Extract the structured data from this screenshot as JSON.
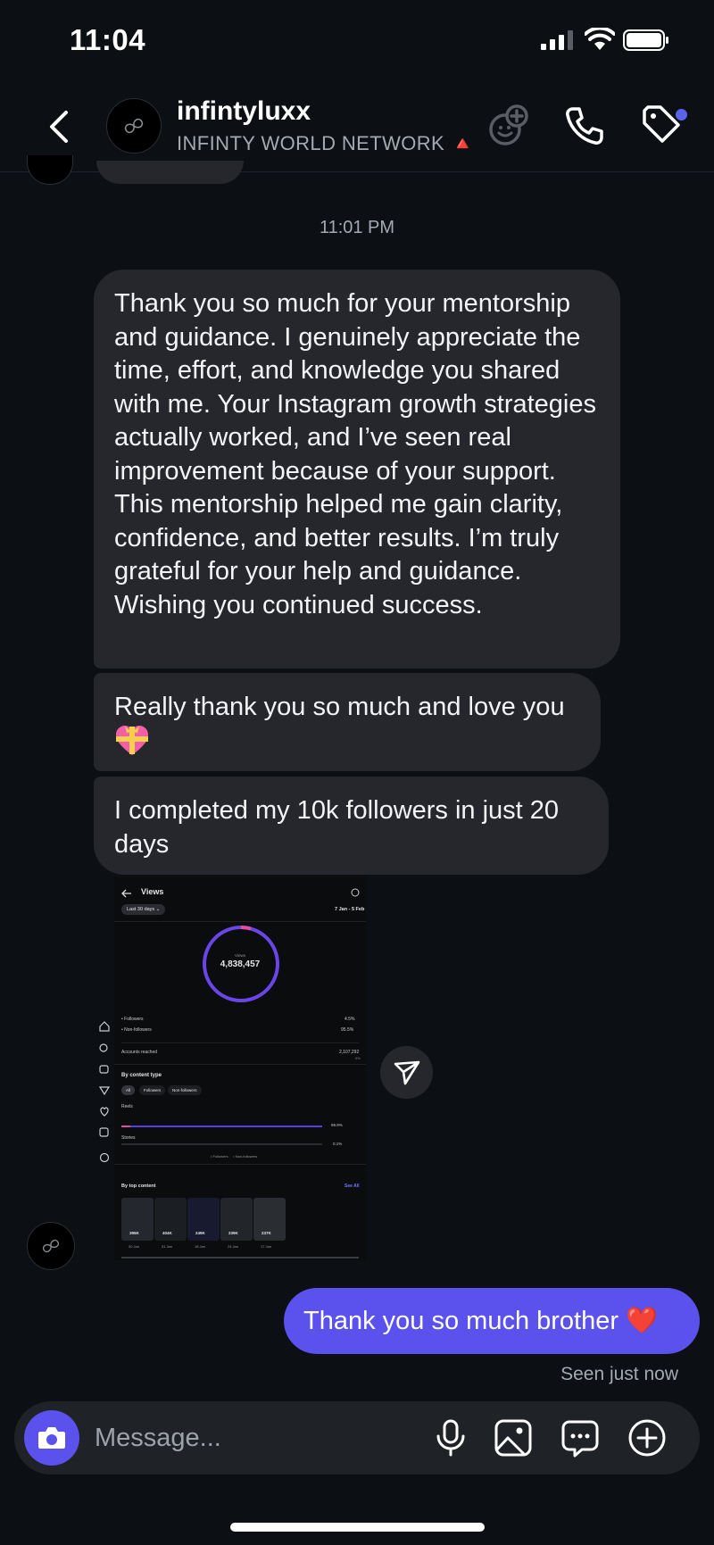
{
  "status_bar": {
    "time": "11:04"
  },
  "header": {
    "name": "infintyluxx",
    "subtitle": "INFINTY WORLD NETWORK 🔺",
    "icons": [
      "back-icon",
      "effects-icon",
      "phone-icon",
      "tag-icon"
    ]
  },
  "divider": {
    "time": "11:01 PM"
  },
  "messages": {
    "m1": "Thank you so much for your mentorship and guidance. I genuinely appreciate the time, effort, and knowledge you shared with me. Your Instagram growth strategies actually worked, and I’ve seen real improvement because of your support. This mentorship helped me gain clarity, confidence, and better results. I’m truly grateful for your help and guidance. Wishing you continued success.",
    "m2": "Really thank you so much and love you",
    "m3": "I completed my 10k followers in just 20 days",
    "out": "Thank you so much brother ❤️",
    "seen": "Seen just now"
  },
  "screenshot": {
    "title": "Views",
    "range_chip": "Last 30 days ⌄",
    "date_range": "7 Jan - 5 Feb",
    "donut_label": "Views",
    "total_views": "4,838,457",
    "followers_label": "• Followers",
    "followers_pct": "4.5%",
    "nonfollowers_label": "• Non-followers",
    "nonfollowers_pct": "95.5%",
    "accounts_label": "Accounts reached",
    "accounts_value": "2,107,292",
    "accounts_change": "0%",
    "content_type_title": "By content type",
    "chips": [
      "All",
      "Followers",
      "Non-followers"
    ],
    "reels_label": "Reels",
    "reels_pct": "99.9%",
    "stories_label": "Stories",
    "stories_pct": "0.1%",
    "legend": "• Followers     • Non-followers",
    "top_content_title": "By top content",
    "see_all": "See All",
    "thumbs": [
      {
        "views": "395K",
        "date": "30 Jan"
      },
      {
        "views": "404K",
        "date": "31 Jan"
      },
      {
        "views": "249K",
        "date": "18 Jan"
      },
      {
        "views": "239K",
        "date": "24 Jan"
      },
      {
        "views": "237K",
        "date": "17 Jan"
      }
    ]
  },
  "composer": {
    "placeholder": "Message..."
  },
  "colors": {
    "accent": "#5b51ec",
    "bubble_in": "#25272d",
    "background": "#0c0f14"
  }
}
